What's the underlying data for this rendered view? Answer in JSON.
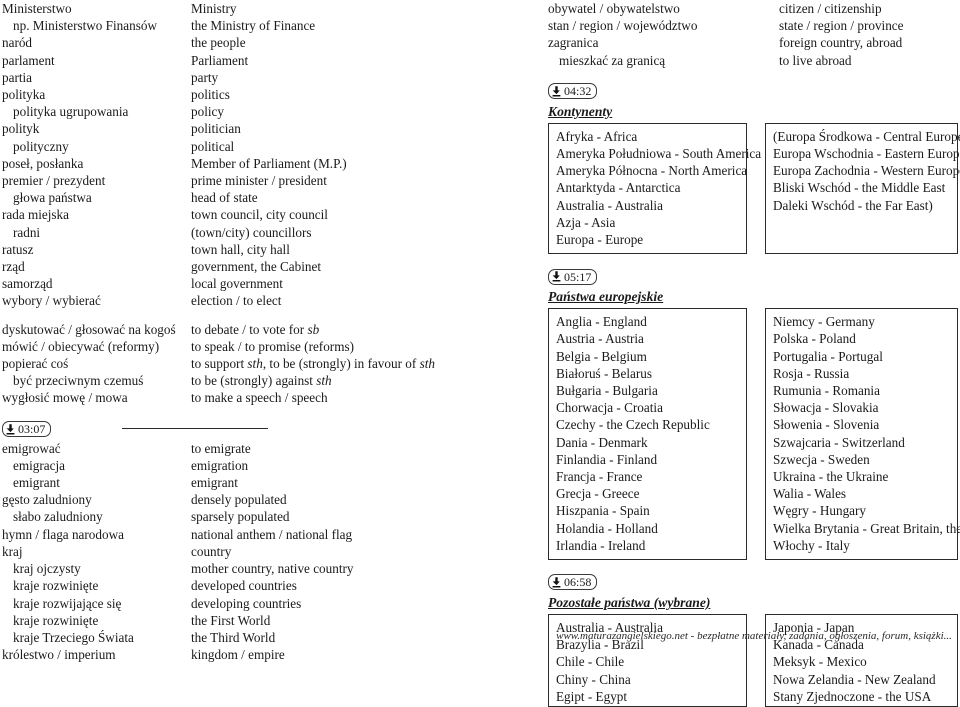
{
  "left_column": {
    "groups": [
      {
        "id": "politics-nouns",
        "rows": [
          {
            "term": "Ministerstwo",
            "translation": "Ministry",
            "indent": false
          },
          {
            "term": "np. Ministerstwo Finansów",
            "translation": "the Ministry of Finance",
            "indent": true
          },
          {
            "term": "naród",
            "translation": "the people",
            "indent": false
          },
          {
            "term": "parlament",
            "translation": "Parliament",
            "indent": false
          },
          {
            "term": "partia",
            "translation": "party",
            "indent": false
          },
          {
            "term": "polityka",
            "translation": "politics",
            "indent": false
          },
          {
            "term": "polityka ugrupowania",
            "translation": "policy",
            "indent": true
          },
          {
            "term": "polityk",
            "translation": "politician",
            "indent": false
          },
          {
            "term": "polityczny",
            "translation": "political",
            "indent": true
          },
          {
            "term": "poseł, posłanka",
            "translation": "Member of Parliament (M.P.)",
            "indent": false
          },
          {
            "term": "premier / prezydent",
            "translation": "prime minister / president",
            "indent": false
          },
          {
            "term": "głowa państwa",
            "translation": "head of state",
            "indent": true
          },
          {
            "term": "rada miejska",
            "translation": "town council, city council",
            "indent": false
          },
          {
            "term": "radni",
            "translation": "(town/city) councillors",
            "indent": true
          },
          {
            "term": "ratusz",
            "translation": "town hall, city hall",
            "indent": false
          },
          {
            "term": "rząd",
            "translation": "government, the Cabinet",
            "indent": false
          },
          {
            "term": "samorząd",
            "translation": "local government",
            "indent": false
          },
          {
            "term": "wybory / wybierać",
            "translation": "election / to elect",
            "indent": false
          }
        ]
      },
      {
        "id": "politics-verbs",
        "rows": [
          {
            "term": "dyskutować / głosować na kogoś",
            "translation": "to debate / to vote for ",
            "translation_italic_tail": "sb",
            "indent": false
          },
          {
            "term": "mówić / obiecywać (reformy)",
            "translation": "to speak / to promise (reforms)",
            "indent": false
          },
          {
            "term": "popierać coś",
            "translation": "to support ",
            "translation_italic_tail": "sth",
            "translation_tail2": ", to be (strongly) in favour of ",
            "translation_italic_tail2": "sth",
            "indent": false
          },
          {
            "term": "być przeciwnym czemuś",
            "translation": "to be (strongly) against ",
            "translation_italic_tail": "sth",
            "indent": true
          },
          {
            "term": "wygłosić mowę / mowa",
            "translation": "to make a speech / speech",
            "indent": false
          }
        ]
      },
      {
        "id": "migration-country",
        "badge": {
          "icon": "download-icon",
          "time": "03:07"
        },
        "rows": [
          {
            "term": "emigrować",
            "translation": "to emigrate",
            "indent": false
          },
          {
            "term": "emigracja",
            "translation": "emigration",
            "indent": true
          },
          {
            "term": "emigrant",
            "translation": "emigrant",
            "indent": true
          },
          {
            "term": "gęsto zaludniony",
            "translation": "densely populated",
            "indent": false
          },
          {
            "term": "słabo zaludniony",
            "translation": "sparsely populated",
            "indent": true
          },
          {
            "term": "hymn / flaga narodowa",
            "translation": "national anthem / national flag",
            "indent": false
          },
          {
            "term": "kraj",
            "translation": "country",
            "indent": false
          },
          {
            "term": "kraj ojczysty",
            "translation": "mother country, native country",
            "indent": true
          },
          {
            "term": "kraje rozwinięte",
            "translation": "developed countries",
            "indent": true
          },
          {
            "term": "kraje rozwijające się",
            "translation": "developing countries",
            "indent": true
          },
          {
            "term": "kraje rozwinięte",
            "translation": "the First World",
            "indent": true
          },
          {
            "term": "kraje Trzeciego Świata",
            "translation": "the Third World",
            "indent": true
          },
          {
            "term": "królestwo / imperium",
            "translation": "kingdom / empire",
            "indent": false
          }
        ]
      }
    ]
  },
  "right_column": {
    "groups": [
      {
        "id": "citizenship",
        "rows": [
          {
            "term": "obywatel / obywatelstwo",
            "translation": "citizen / citizenship",
            "indent": false
          },
          {
            "term": "stan / region / województwo",
            "translation": "state / region / province",
            "indent": false
          },
          {
            "term": "zagranica",
            "translation": "foreign country, abroad",
            "indent": false
          },
          {
            "term": "mieszkać za granicą",
            "translation": "to live abroad",
            "indent": true
          }
        ]
      }
    ],
    "sections": [
      {
        "id": "continents",
        "badge": {
          "icon": "download-icon",
          "time": "04:32"
        },
        "heading": "Kontynenty",
        "box_left": [
          "Afryka - Africa",
          "Ameryka Południowa - South America",
          "Ameryka Północna - North America",
          "Antarktyda - Antarctica",
          "Australia - Australia",
          "Azja - Asia",
          "Europa - Europe"
        ],
        "box_right": [
          "(Europa Środkowa - Central Europe",
          "Europa Wschodnia - Eastern Europe",
          "Europa Zachodnia - Western Europe",
          "Bliski Wschód - the Middle East",
          "Daleki Wschód - the Far East)"
        ]
      },
      {
        "id": "european-countries",
        "badge": {
          "icon": "download-icon",
          "time": "05:17"
        },
        "heading": "Państwa europejskie",
        "box_left": [
          "Anglia - England",
          "Austria - Austria",
          "Belgia - Belgium",
          "Białoruś - Belarus",
          "Bułgaria - Bulgaria",
          "Chorwacja - Croatia",
          "Czechy - the Czech Republic",
          "Dania - Denmark",
          "Finlandia - Finland",
          "Francja - France",
          "Grecja - Greece",
          "Hiszpania - Spain",
          "Holandia - Holland",
          "Irlandia - Ireland"
        ],
        "box_right": [
          "Niemcy - Germany",
          "Polska - Poland",
          "Portugalia - Portugal",
          "Rosja - Russia",
          "Rumunia - Romania",
          "Słowacja - Slovakia",
          "Słowenia - Slovenia",
          "Szwajcaria - Switzerland",
          "Szwecja - Sweden",
          "Ukraina - the Ukraine",
          "Walia - Wales",
          "Węgry - Hungary",
          "Wielka Brytania - Great Britain, the UK",
          "Włochy - Italy"
        ]
      },
      {
        "id": "other-countries",
        "badge": {
          "icon": "download-icon",
          "time": "06:58"
        },
        "heading": "Pozostałe państwa (wybrane)",
        "box_left": [
          "Australia - Australia",
          "Brazylia - Brazil",
          "Chile - Chile",
          "Chiny - China",
          "Egipt - Egypt"
        ],
        "box_right": [
          "Japonia - Japan",
          "Kanada - Canada",
          "Meksyk - Mexico",
          "Nowa Zelandia - New Zealand",
          "Stany Zjednoczone - the USA"
        ]
      }
    ]
  },
  "footer": {
    "text": "www.maturazangielskiego.net - bezpłatne materiały, zadania, ogłoszenia, forum, książki..."
  },
  "colors": {
    "text": "#1a1a1a",
    "border": "#2b2b2b",
    "background": "#ffffff"
  }
}
